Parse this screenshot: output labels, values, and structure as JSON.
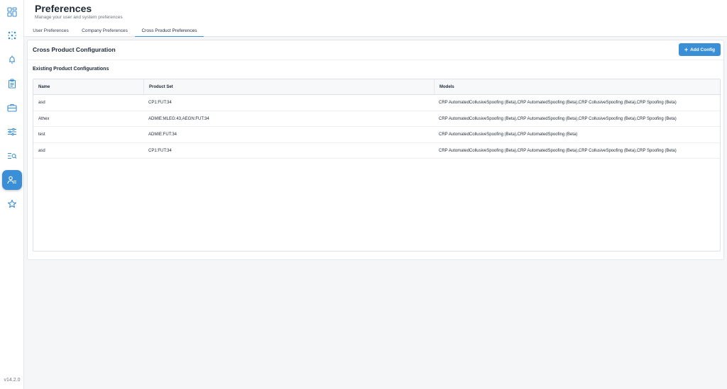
{
  "app": {
    "version": "v14.2.0"
  },
  "header": {
    "title": "Preferences",
    "subtitle": "Manage your user and system preferences"
  },
  "sidebar": {
    "items": [
      {
        "icon": "dashboard-icon"
      },
      {
        "icon": "network-icon"
      },
      {
        "icon": "bell-icon"
      },
      {
        "icon": "clipboard-icon"
      },
      {
        "icon": "briefcase-icon"
      },
      {
        "icon": "sliders-icon"
      },
      {
        "icon": "search-list-icon"
      },
      {
        "icon": "user-settings-icon",
        "active": true
      },
      {
        "icon": "star-icon"
      }
    ]
  },
  "tabs": [
    {
      "label": "User Preferences"
    },
    {
      "label": "Company Preferences"
    },
    {
      "label": "Cross Product Preferences",
      "active": true
    }
  ],
  "panel": {
    "title": "Cross Product Configuration",
    "add_button_label": "Add Config",
    "section_title": "Existing Product Configurations"
  },
  "table": {
    "headers": {
      "name": "Name",
      "product_set": "Product Set",
      "models": "Models"
    },
    "rows": [
      {
        "name": "asd",
        "product_set": "CP1:FUT:34",
        "models": "CRP AutomatedCollusiveSpoofing (Beta),CRP AutomatedSpoofing (Beta),CRP CollusiveSpoofing (Beta),CRP Spoofing (Beta)"
      },
      {
        "name": "Athex",
        "product_set": "ADMIE:MLEG:43,AEGN:FUT:34",
        "models": "CRP AutomatedCollusiveSpoofing (Beta),CRP AutomatedSpoofing (Beta),CRP CollusiveSpoofing (Beta),CRP Spoofing (Beta)"
      },
      {
        "name": "test",
        "product_set": "ADMIE:FUT:34",
        "models": "CRP AutomatedCollusiveSpoofing (Beta),CRP AutomatedSpoofing (Beta)"
      },
      {
        "name": "asd",
        "product_set": "CP1:FUT:34",
        "models": "CRP AutomatedCollusiveSpoofing (Beta),CRP AutomatedSpoofing (Beta),CRP CollusiveSpoofing (Beta),CRP Spoofing (Beta)"
      }
    ]
  },
  "colors": {
    "accent": "#3b8fd6",
    "sidebar_icon": "#3b8fd6",
    "text": "#1f2a37",
    "muted": "#6b7280"
  }
}
